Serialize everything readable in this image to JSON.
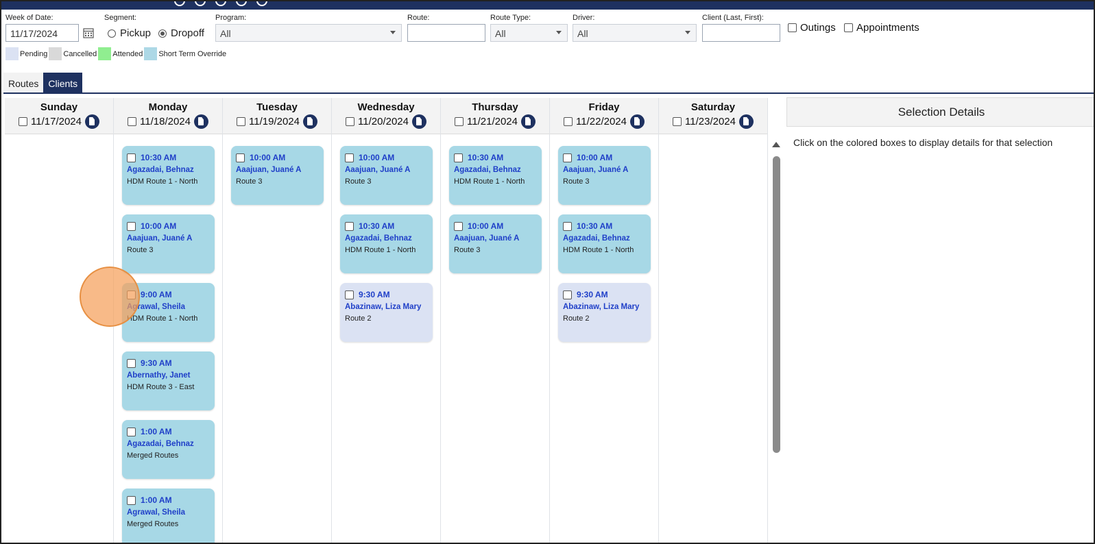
{
  "colors": {
    "brand_navy": "#1e3160",
    "card_blue": "#a7d8e6",
    "card_pending": "#dbe2f3",
    "link_blue": "#1f3fc8",
    "legend_pending": "#dbe2f3",
    "legend_cancelled": "#d9d9d9",
    "legend_attended": "#90ee90",
    "legend_override": "#add8e6"
  },
  "filters": {
    "week_label": "Week of Date:",
    "week_value": "11/17/2024",
    "segment_label": "Segment:",
    "pickup_label": "Pickup",
    "dropoff_label": "Dropoff",
    "segment_selected": "Dropoff",
    "program_label": "Program:",
    "program_value": "All",
    "route_label": "Route:",
    "route_value": "",
    "route_type_label": "Route Type:",
    "route_type_value": "All",
    "driver_label": "Driver:",
    "driver_value": "All",
    "client_label": "Client (Last, First):",
    "client_value": "",
    "outings_label": "Outings",
    "appointments_label": "Appointments"
  },
  "legend": {
    "pending": "Pending",
    "cancelled": "Cancelled",
    "attended": "Attended",
    "override": "Short Term Override"
  },
  "tabs": {
    "routes": "Routes",
    "clients": "Clients",
    "active": "Clients"
  },
  "days": [
    {
      "name": "Sunday",
      "date": "11/17/2024",
      "cards": []
    },
    {
      "name": "Monday",
      "date": "11/18/2024",
      "cards": [
        {
          "time": "10:30 AM",
          "client": "Agazadai, Behnaz",
          "route": "HDM Route 1 - North",
          "status": "override"
        },
        {
          "time": "10:00 AM",
          "client": "Aaajuan, Juané A",
          "route": "Route 3",
          "status": "override"
        },
        {
          "time": "9:00 AM",
          "client": "Agrawal, Sheila",
          "route": "HDM Route 1 - North",
          "status": "override"
        },
        {
          "time": "9:30 AM",
          "client": "Abernathy, Janet",
          "route": "HDM Route 3 - East",
          "status": "override"
        },
        {
          "time": "1:00 AM",
          "client": "Agazadai, Behnaz",
          "route": "Merged Routes",
          "status": "override"
        },
        {
          "time": "1:00 AM",
          "client": "Agrawal, Sheila",
          "route": "Merged Routes",
          "status": "override"
        }
      ]
    },
    {
      "name": "Tuesday",
      "date": "11/19/2024",
      "cards": [
        {
          "time": "10:00 AM",
          "client": "Aaajuan, Juané A",
          "route": "Route 3",
          "status": "override"
        }
      ]
    },
    {
      "name": "Wednesday",
      "date": "11/20/2024",
      "cards": [
        {
          "time": "10:00 AM",
          "client": "Aaajuan, Juané A",
          "route": "Route 3",
          "status": "override"
        },
        {
          "time": "10:30 AM",
          "client": "Agazadai, Behnaz",
          "route": "HDM Route 1 - North",
          "status": "override"
        },
        {
          "time": "9:30 AM",
          "client": "Abazinaw, Liza Mary",
          "route": "Route 2",
          "status": "pending"
        }
      ]
    },
    {
      "name": "Thursday",
      "date": "11/21/2024",
      "cards": [
        {
          "time": "10:30 AM",
          "client": "Agazadai, Behnaz",
          "route": "HDM Route 1 - North",
          "status": "override"
        },
        {
          "time": "10:00 AM",
          "client": "Aaajuan, Juané A",
          "route": "Route 3",
          "status": "override"
        }
      ]
    },
    {
      "name": "Friday",
      "date": "11/22/2024",
      "cards": [
        {
          "time": "10:00 AM",
          "client": "Aaajuan, Juané A",
          "route": "Route 3",
          "status": "override"
        },
        {
          "time": "10:30 AM",
          "client": "Agazadai, Behnaz",
          "route": "HDM Route 1 - North",
          "status": "override"
        },
        {
          "time": "9:30 AM",
          "client": "Abazinaw, Liza Mary",
          "route": "Route 2",
          "status": "pending"
        }
      ]
    },
    {
      "name": "Saturday",
      "date": "11/23/2024",
      "cards": []
    }
  ],
  "selection": {
    "title": "Selection Details",
    "hint": "Click on the colored boxes to display details for that selection"
  }
}
